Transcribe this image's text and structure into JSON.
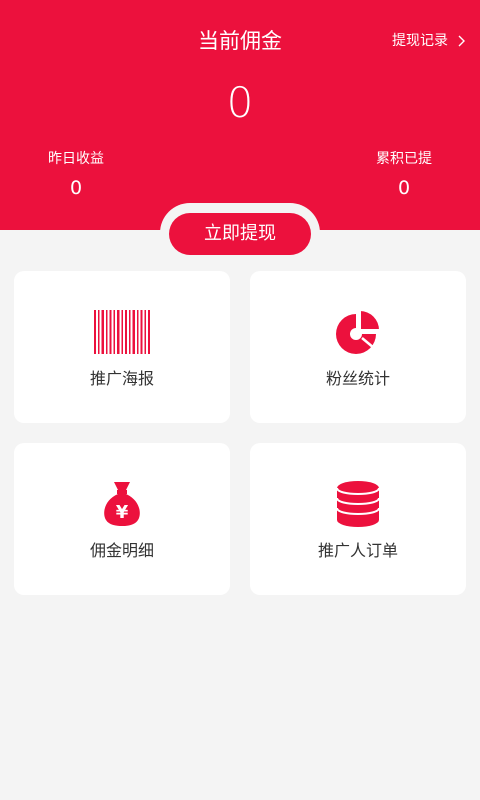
{
  "header": {
    "title": "当前佣金",
    "history_link": "提现记录",
    "amount": "0",
    "yesterday_label": "昨日收益",
    "yesterday_value": "0",
    "total_label": "累积已提",
    "total_value": "0"
  },
  "withdraw_button": "立即提现",
  "cards": [
    {
      "label": "推广海报",
      "icon": "barcode-icon"
    },
    {
      "label": "粉丝统计",
      "icon": "pie-chart-icon"
    },
    {
      "label": "佣金明细",
      "icon": "money-bag-icon"
    },
    {
      "label": "推广人订单",
      "icon": "coin-stack-icon"
    }
  ],
  "colors": {
    "brand_red": "#ec113d",
    "background": "#f4f4f4",
    "card": "#ffffff",
    "text": "#333333"
  }
}
